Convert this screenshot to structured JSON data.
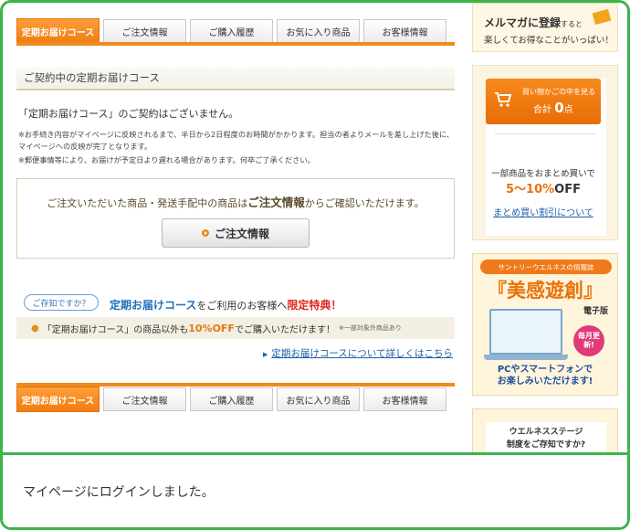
{
  "tabs": [
    {
      "label": "定期お届けコース",
      "active": true
    },
    {
      "label": "ご注文情報",
      "active": false
    },
    {
      "label": "ご購入履歴",
      "active": false
    },
    {
      "label": "お気に入り商品",
      "active": false
    },
    {
      "label": "お客様情報",
      "active": false
    }
  ],
  "section": {
    "title": "ご契約中の定期お届けコース"
  },
  "notice": "「定期お届けコース」のご契約はございません。",
  "notes": [
    "※お手続き内容がマイページに反映されるまで、半日から2日程度のお時間がかかります。担当の者よりメールを差し上げた後に、マイページへの反映が完了となります。",
    "※郵便事情等により、お届けが予定日より遅れる場合があります。何卒ご了承ください。"
  ],
  "inquiry": {
    "text_before": "ご注文いただいた商品・発送手配中の商品は",
    "text_bold": "ご注文情報",
    "text_after": "からご確認いただけます。",
    "button_label": "ご注文情報"
  },
  "promo": {
    "badge": "ご存知ですか？",
    "title_blue": "定期お届けコース",
    "title_mid": "をご利用のお客様へ",
    "title_red": "限定特典！",
    "band_before": "「定期お届けコース」の商品以外も",
    "band_off": "10%OFF",
    "band_after": "でご購入いただけます！",
    "band_small": "※一部対象外商品あり",
    "link": "定期お届けコースについて詳しくはこちら"
  },
  "sidebar": {
    "mailmag_line1": "メルマガに登録",
    "mailmag_line1_small": "すると",
    "mailmag_line2": "楽しくてお得なことがいっぱい！",
    "cart_line1": "買い物かごの中を見る",
    "cart_total_label": "合計",
    "cart_total_value": "0",
    "cart_total_unit": "点",
    "bulk_line1": "一部商品をおまとめ買いで",
    "bulk_discount": "5～10%",
    "bulk_off": "OFF",
    "bulk_link": "まとめ買い割引について",
    "ebook_header": "サントリーウエルネスの情報誌",
    "ebook_title": "『美感遊創』",
    "ebook_sub": "電子版",
    "ebook_badge": "毎月更新!",
    "ebook_footer1": "PCやスマートフォンで",
    "ebook_footer2": "お楽しみいただけます!",
    "wellness_line1": "ウエルネスステージ",
    "wellness_line2": "制度をご存知ですか?"
  },
  "toast": {
    "message": "マイページにログインしました。"
  },
  "colors": {
    "accent": "#f08a1e",
    "frame": "#3cb44b",
    "link": "#1e5fa8"
  }
}
